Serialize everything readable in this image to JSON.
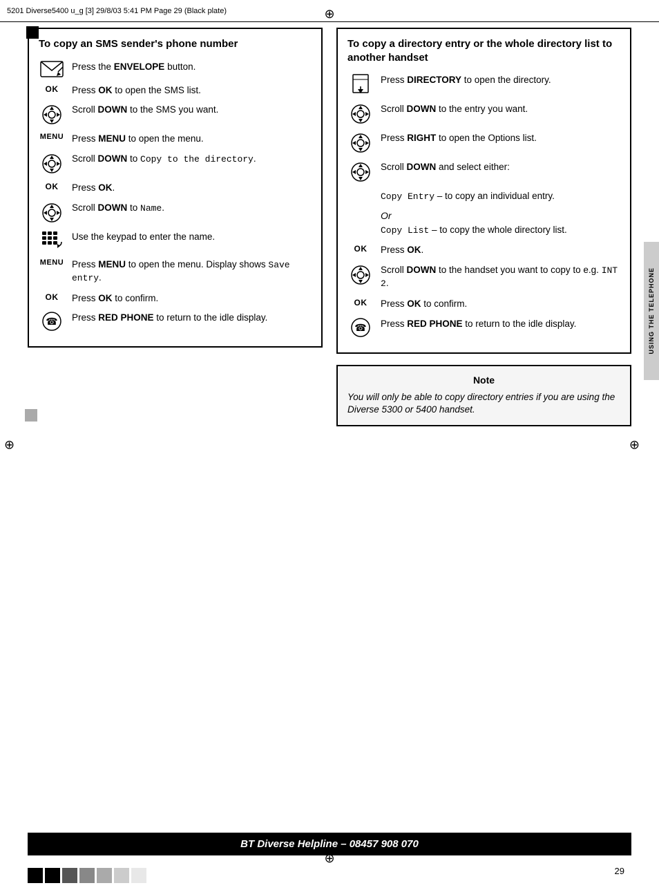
{
  "header": {
    "text": "5201  Diverse5400   u_g [3]  29/8/03  5:41 PM  Page 29    (Black plate)"
  },
  "left_section": {
    "title": "To copy an SMS sender's phone number",
    "steps": [
      {
        "icon_type": "envelope",
        "text": "Press the <b>ENVELOPE</b> button."
      },
      {
        "icon_type": "ok",
        "text": "Press <b>OK</b> to open the SMS list."
      },
      {
        "icon_type": "scroll",
        "text": "Scroll <b>DOWN</b> to the SMS you want."
      },
      {
        "icon_type": "menu",
        "text": "Press <b>MENU</b> to open the menu."
      },
      {
        "icon_type": "scroll",
        "text": "Scroll <b>DOWN</b> to <span class='mono'>Copy to the directory</span>."
      },
      {
        "icon_type": "ok",
        "text": "Press <b>OK</b>."
      },
      {
        "icon_type": "scroll",
        "text": "Scroll <b>DOWN</b> to <span class='mono'>Name</span>."
      },
      {
        "icon_type": "keypad",
        "text": "Use the keypad to enter the name."
      },
      {
        "icon_type": "menu",
        "text": "Press <b>MENU</b> to open the menu. Display shows <span class='mono'>Save entry</span>."
      },
      {
        "icon_type": "ok",
        "text": "Press <b>OK</b> to confirm."
      },
      {
        "icon_type": "phone_red",
        "text": "Press <b>RED PHONE</b> to return to the idle display."
      }
    ]
  },
  "right_section": {
    "title": "To copy a directory entry or the whole directory list to another handset",
    "steps": [
      {
        "icon_type": "directory",
        "text": "Press <b>DIRECTORY</b> to open the directory."
      },
      {
        "icon_type": "scroll",
        "text": "Scroll <b>DOWN</b> to the entry you want."
      },
      {
        "icon_type": "scroll",
        "text": "Press <b>RIGHT</b> to open the Options list."
      },
      {
        "icon_type": "scroll",
        "text": "Scroll <b>DOWN</b> and select either:"
      },
      {
        "icon_type": "none",
        "text": "<span class='mono'>Copy Entry</span> – to copy an individual entry."
      },
      {
        "icon_type": "none_or",
        "text": "<i>Or</i>"
      },
      {
        "icon_type": "none",
        "text": "<span class='mono'>Copy List</span> – to copy the whole directory list."
      },
      {
        "icon_type": "ok",
        "text": "Press <b>OK</b>."
      },
      {
        "icon_type": "scroll",
        "text": "Scroll <b>DOWN</b> to the handset you want to copy to e.g. <span class='mono'>INT 2</span>."
      },
      {
        "icon_type": "ok",
        "text": "Press <b>OK</b> to confirm."
      },
      {
        "icon_type": "phone_red",
        "text": "Press <b>RED PHONE</b> to return to the idle display."
      }
    ],
    "note": {
      "title": "Note",
      "text": "You will only be able to copy directory entries if you are using the Diverse 5300 or 5400 handset."
    }
  },
  "footer": {
    "text": "BT Diverse Helpline – 08457 908 070"
  },
  "side_tab": {
    "text": "USING THE TELEPHONE"
  },
  "page_number": "29"
}
